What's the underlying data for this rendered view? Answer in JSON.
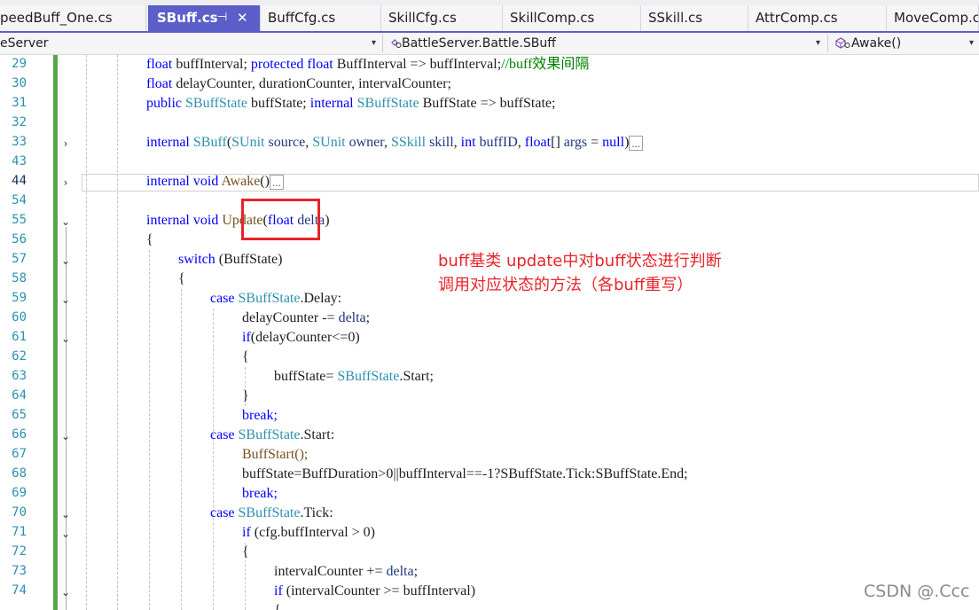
{
  "tabs": [
    {
      "label": "peedBuff_One.cs"
    },
    {
      "label": "SBuff.cs",
      "pin": "⊣",
      "close": "✕"
    },
    {
      "label": "BuffCfg.cs"
    },
    {
      "label": "SkillCfg.cs"
    },
    {
      "label": "SkillComp.cs"
    },
    {
      "label": "SSkill.cs"
    },
    {
      "label": "AttrComp.cs"
    },
    {
      "label": "MoveComp.cs"
    }
  ],
  "nav": {
    "project": "eServer",
    "type": "BattleServer.Battle.SBuff",
    "member": "Awake()",
    "dropdown_glyph": "▾"
  },
  "line_numbers": [
    "29",
    "30",
    "31",
    "32",
    "33",
    "43",
    "44",
    "54",
    "55",
    "56",
    "57",
    "58",
    "59",
    "60",
    "61",
    "62",
    "63",
    "64",
    "65",
    "66",
    "67",
    "68",
    "69",
    "70",
    "71",
    "72",
    "73",
    "74"
  ],
  "current_line": "44",
  "code": {
    "l29": [
      "float",
      "buffInterval;",
      "protected",
      "float",
      "BuffInterval",
      "=>",
      "buffInterval;",
      "//buff效果间隔"
    ],
    "l30": [
      "float",
      "delayCounter, durationCounter, intervalCounter;"
    ],
    "l31": [
      "public",
      "SBuffState",
      "buffState;",
      "internal",
      "SBuffState",
      "BuffState",
      "=>",
      "buffState;"
    ],
    "l33": [
      "internal",
      "SBuff",
      "SUnit",
      "source",
      "SUnit",
      "owner",
      "SSkill",
      "skill",
      "int",
      "buffID",
      "float",
      "args",
      "null"
    ],
    "l44": [
      "internal",
      "void",
      "Awake"
    ],
    "l55": [
      "internal",
      "void",
      "Update",
      "float",
      "delta"
    ],
    "l56": "{",
    "l57": [
      "switch",
      "(BuffState)"
    ],
    "l58": "{",
    "l59": [
      "case",
      "SBuffState",
      "Delay"
    ],
    "l60": [
      "delayCounter",
      "-=",
      "delta"
    ],
    "l61": [
      "if",
      "(delayCounter<=0)"
    ],
    "l62": "{",
    "l63": [
      "buffState=",
      "SBuffState",
      "Start"
    ],
    "l64": "}",
    "l65": "break;",
    "l66": [
      "case",
      "SBuffState",
      "Start"
    ],
    "l67": "BuffStart();",
    "l68": "buffState=BuffDuration>0||buffInterval==-1?SBuffState.Tick:SBuffState.End;",
    "l69": "break;",
    "l70": [
      "case",
      "SBuffState",
      "Tick"
    ],
    "l71": [
      "if",
      "(cfg.buffInterval > 0)"
    ],
    "l72": "{",
    "l73": [
      "intervalCounter",
      "+=",
      "delta"
    ],
    "l74": [
      "if",
      "(intervalCounter >= buffInterval)"
    ],
    "l75": "{"
  },
  "collapsed_marker": "...",
  "annotation": {
    "line1": "buff基类 update中对buff状态进行判断",
    "line2": "调用对应状态的方法（各buff重写）"
  },
  "watermark": "CSDN @.Ccc",
  "colors": {
    "accent_tab": "#5b5fc7",
    "keyword": "#0000ff",
    "type": "#2b91af",
    "change_bar": "#57a64a",
    "annotation": "#e8232a"
  }
}
